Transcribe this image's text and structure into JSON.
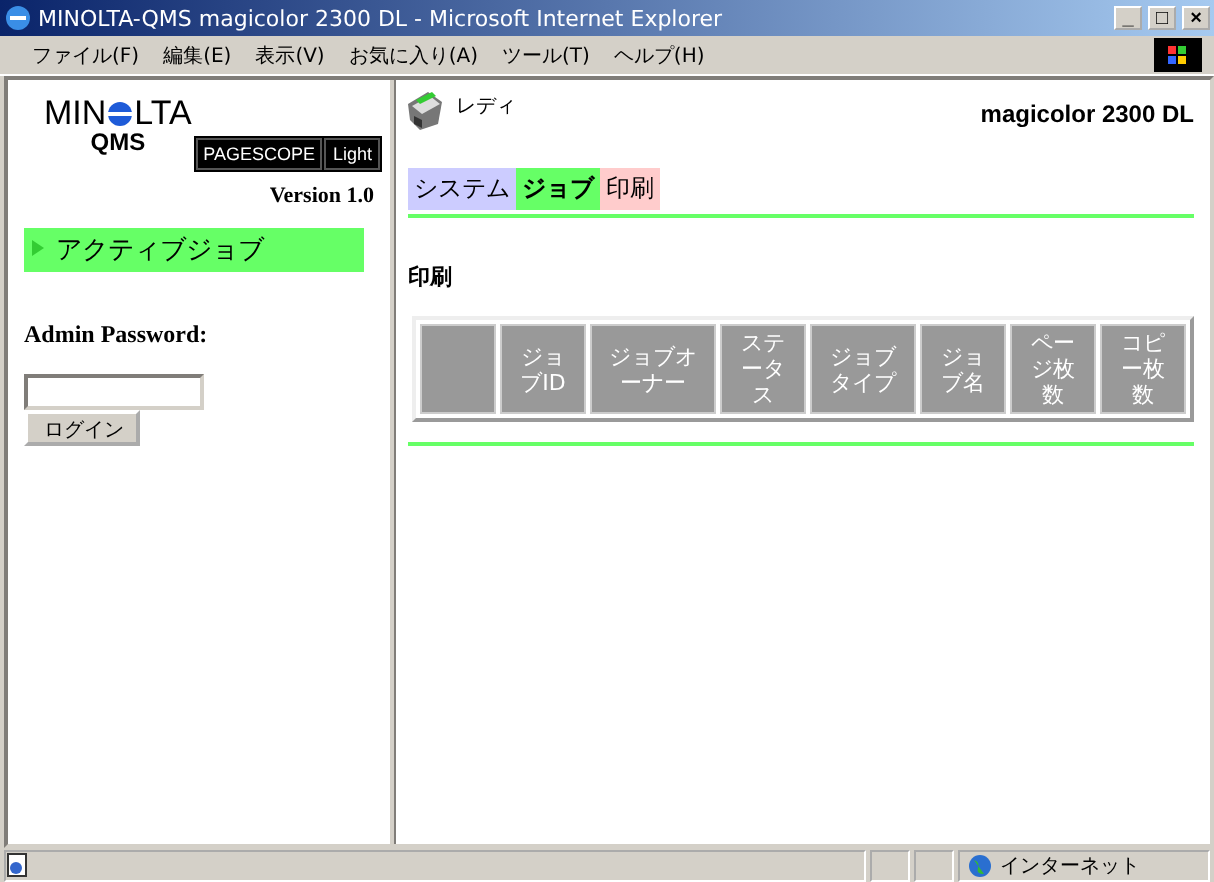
{
  "window": {
    "title": "MINOLTA-QMS magicolor 2300 DL - Microsoft Internet Explorer",
    "controls": [
      "_",
      "□",
      "×"
    ]
  },
  "menu": [
    "ファイル(F)",
    "編集(E)",
    "表示(V)",
    "お気に入り(A)",
    "ツール(T)",
    "ヘルプ(H)"
  ],
  "sidebar": {
    "logo": {
      "parts": [
        "MIN",
        "LTA"
      ],
      "sub": "QMS",
      "badge": [
        "PAGESCOPE",
        "Light"
      ]
    },
    "version": "Version 1.0",
    "items": [
      {
        "label": "アクティブジョブ",
        "selected": true
      }
    ],
    "password_label": "Admin Password:",
    "login_button": "ログイン"
  },
  "main": {
    "status": "レディ",
    "model": "magicolor 2300 DL",
    "tabs": [
      {
        "label": "システム",
        "selected": false,
        "color": "#ccccff"
      },
      {
        "label": "ジョブ",
        "selected": true,
        "color": "#66ff66"
      },
      {
        "label": "印刷",
        "selected": false,
        "color": "#ffcccc"
      }
    ],
    "heading": "印刷",
    "table": {
      "columns": [
        "",
        "ジョブID",
        "ジョブオーナー",
        "ステータス",
        "ジョブタイプ",
        "ジョブ名",
        "ページ枚数",
        "コピー枚数"
      ]
    }
  },
  "status_bar": {
    "zone": "インターネット"
  }
}
